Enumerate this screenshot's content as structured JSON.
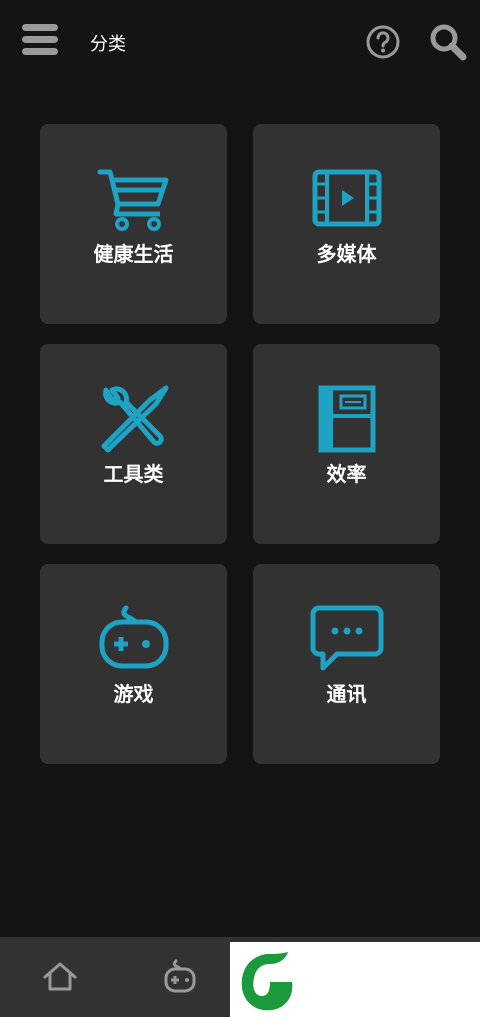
{
  "header": {
    "title": "分类",
    "menu_icon": "hamburger-menu-icon",
    "help_icon": "question-mark-circle-icon",
    "search_icon": "magnifier-search-icon"
  },
  "categories": [
    {
      "label": "健康生活",
      "icon": "shopping-cart-icon"
    },
    {
      "label": "多媒体",
      "icon": "film-play-icon"
    },
    {
      "label": "工具类",
      "icon": "wrench-pen-tools-icon"
    },
    {
      "label": "效率",
      "icon": "notebook-icon"
    },
    {
      "label": "游戏",
      "icon": "gamepad-icon"
    },
    {
      "label": "通讯",
      "icon": "chat-bubble-icon"
    }
  ],
  "bottom_nav": {
    "home_icon": "home-icon",
    "games_icon": "gamepad-icon"
  },
  "colors": {
    "background": "#141414",
    "tile": "#323232",
    "accent": "#1ea3c4",
    "icon_gray": "#9a9a9a",
    "brand_green": "#1a9a3c"
  }
}
